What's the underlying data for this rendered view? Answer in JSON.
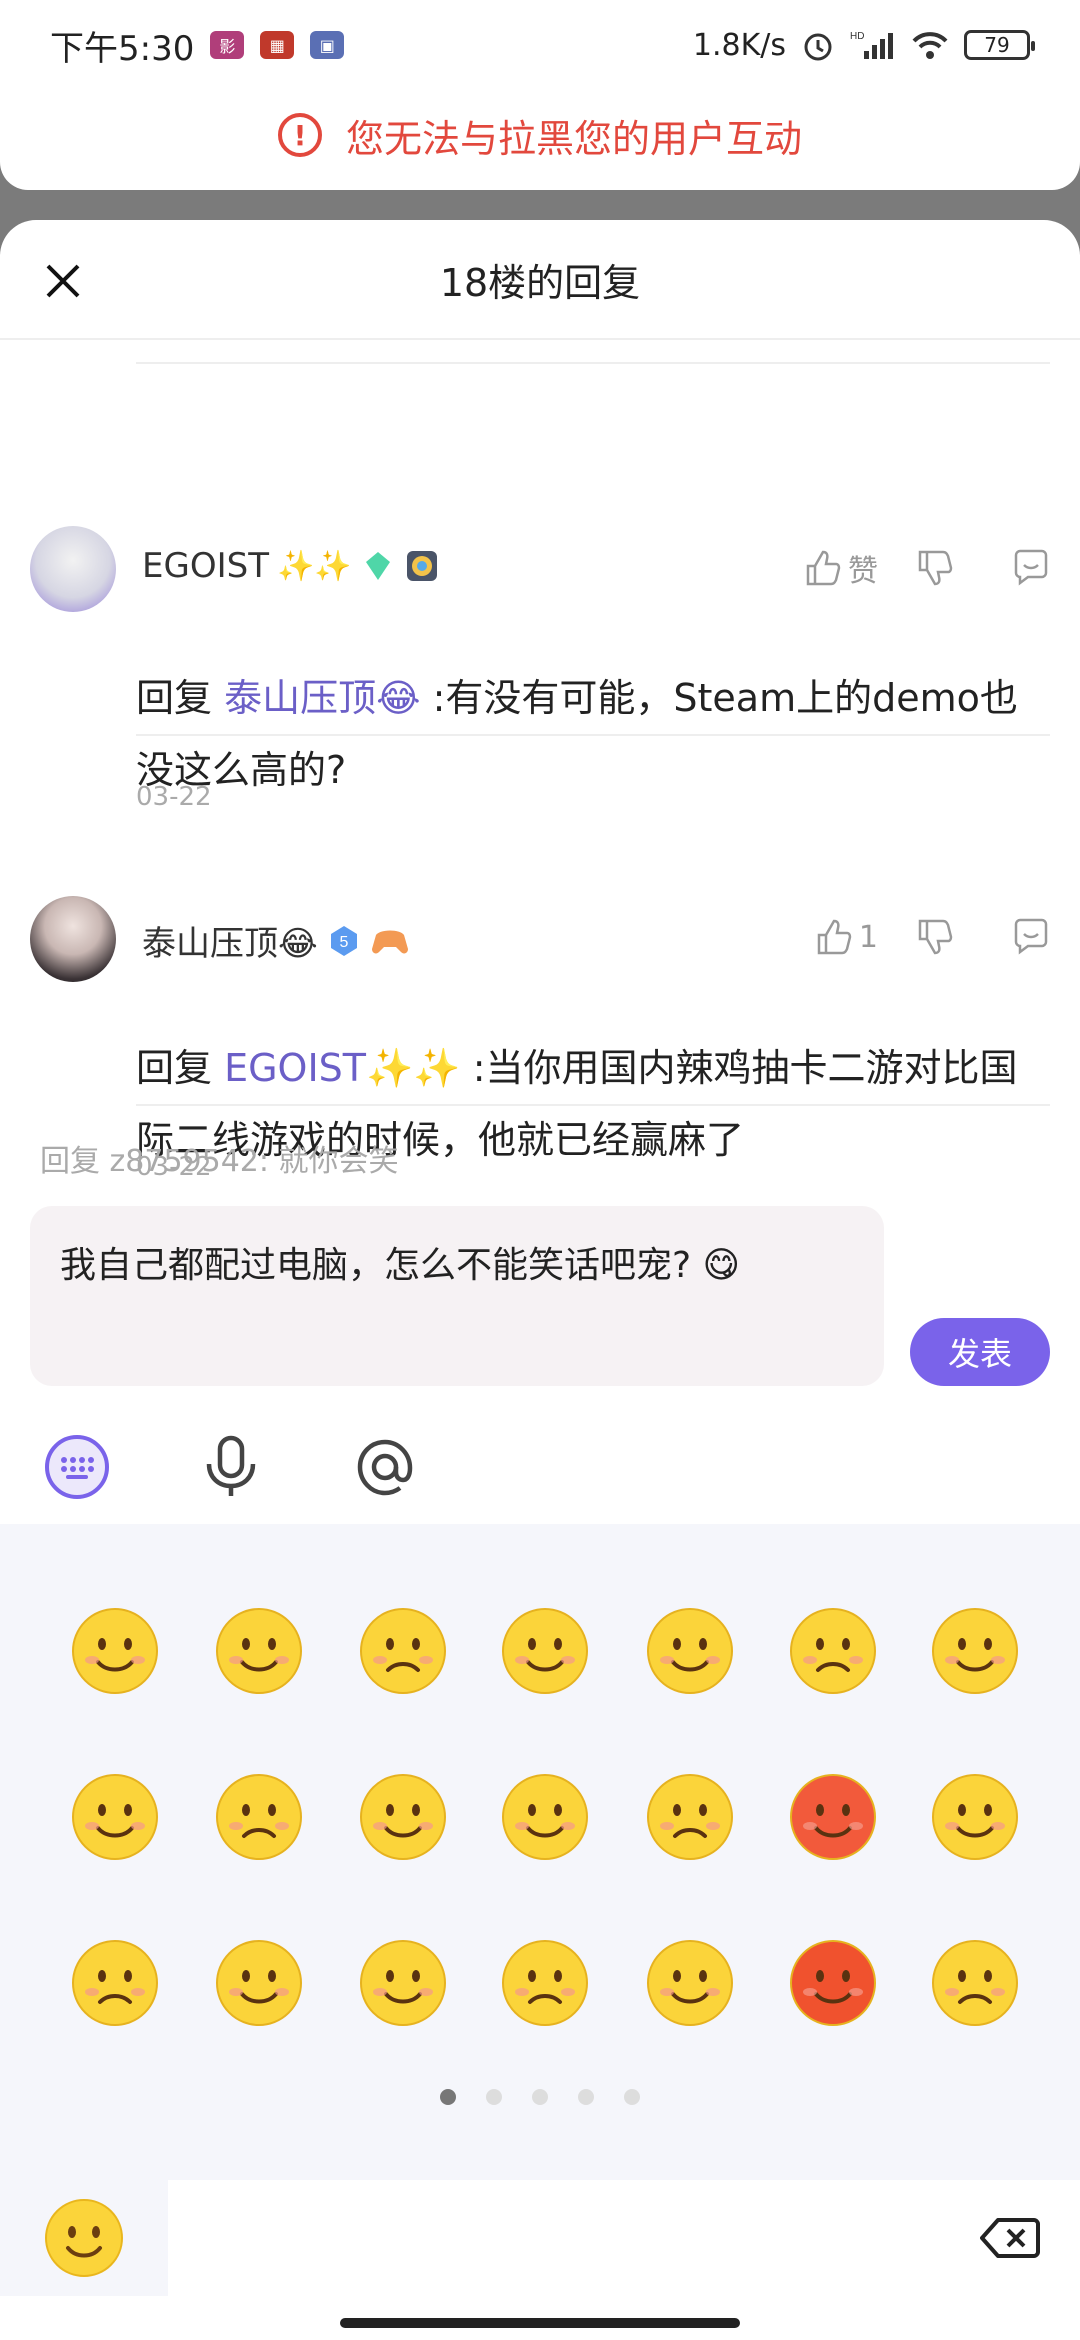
{
  "status_bar": {
    "time": "下午5:30",
    "net_speed": "1.8K/s",
    "hd": "HD",
    "battery": "79"
  },
  "toast": {
    "text": "您无法与拉黑您的用户互动"
  },
  "sheet": {
    "title": "18楼的回复"
  },
  "comments": [
    {
      "username": "EGOIST",
      "like_label": "赞",
      "body_prefix": "回复 ",
      "mention": "泰山压顶😂",
      "body_rest": " :有没有可能，Steam上的demo也没这么高的?",
      "date": "03-22"
    },
    {
      "username": "泰山压顶😂",
      "like_count": "1",
      "badge_level": "5",
      "body_prefix": "回复 ",
      "mention": "EGOIST✨✨",
      "body_rest": " :当你用国内辣鸡抽卡二游对比国际二线游戏的时候，他就已经赢麻了",
      "date": "03-22"
    }
  ],
  "reply": {
    "hint": "回复 z8759542: 就你会笑",
    "text": "我自己都配过电脑，怎么不能笑话吧宠? 😋",
    "send_label": "发表"
  },
  "emoji_panel": {
    "page_count": 5,
    "active_page": 1,
    "emojis": [
      "smile",
      "grin",
      "tongue",
      "hug",
      "laugh",
      "heart-eyes",
      "shy",
      "puppy-eyes",
      "cover-mouth",
      "smug",
      "grimace",
      "frown",
      "angry-teeth",
      "sweat",
      "dizzy",
      "cry",
      "think",
      "sneeze",
      "scared",
      "angry-red",
      "shrug"
    ]
  },
  "colors": {
    "accent": "#7a63ea",
    "error": "#e2483d",
    "mention": "#6b5fc7"
  }
}
